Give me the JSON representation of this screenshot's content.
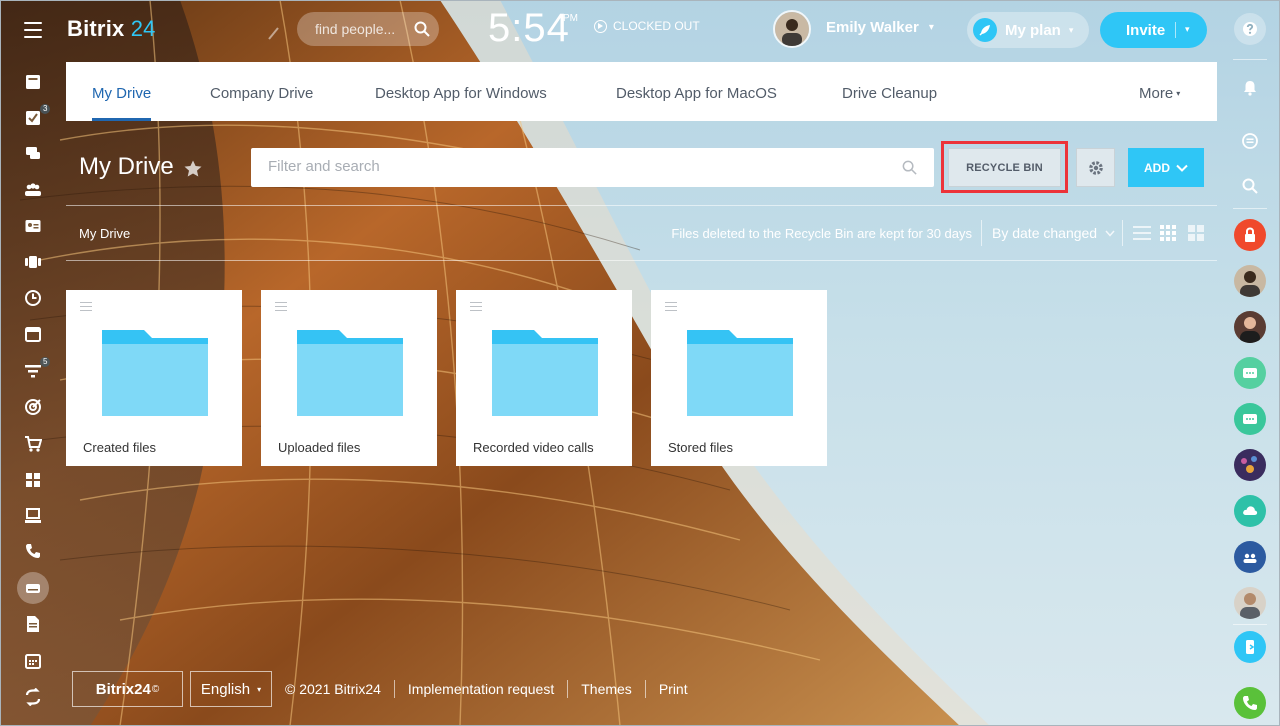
{
  "header": {
    "logo_name": "Bitrix",
    "logo_num": "24",
    "search_placeholder": "find people...",
    "clock_time": "5:54",
    "clock_ampm": "PM",
    "clock_status": "CLOCKED OUT",
    "user_name": "Emily Walker",
    "my_plan_label": "My plan",
    "invite_label": "Invite"
  },
  "left_nav": {
    "badges": {
      "tasks": "3",
      "crm": "5"
    },
    "icons": [
      "feed-icon",
      "tasks-icon",
      "chat-icon",
      "workgroups-icon",
      "contact-card-icon",
      "video-conference-icon",
      "time-clock-icon",
      "calendar-icon",
      "crm-funnel-icon",
      "target-icon",
      "shop-cart-icon",
      "apps-grid-icon",
      "sites-icon",
      "telephony-icon",
      "drive-icon",
      "documents-icon",
      "schedule-icon",
      "sync-icon"
    ]
  },
  "tabs": [
    {
      "label": "My Drive",
      "active": true
    },
    {
      "label": "Company Drive"
    },
    {
      "label": "Desktop App for Windows"
    },
    {
      "label": "Desktop App for MacOS"
    },
    {
      "label": "Drive Cleanup"
    }
  ],
  "tabs_more": "More",
  "toolbar": {
    "page_title": "My Drive",
    "filter_placeholder": "Filter and search",
    "recycle_bin_label": "RECYCLE BIN",
    "add_label": "ADD"
  },
  "info_bar": {
    "breadcrumb": "My Drive",
    "hint": "Files deleted to the Recycle Bin are kept for 30 days",
    "sort_label": "By date changed"
  },
  "folders": [
    {
      "name": "Created files"
    },
    {
      "name": "Uploaded files"
    },
    {
      "name": "Recorded video calls"
    },
    {
      "name": "Stored files"
    }
  ],
  "footer": {
    "logo": "Bitrix24",
    "logo_mark": "©",
    "language": "English",
    "copyright": "© 2021 Bitrix24",
    "links": [
      "Implementation request",
      "Themes",
      "Print"
    ]
  },
  "colors": {
    "accent": "#2fc6f6",
    "active_tab": "#2067b0",
    "highlight": "#ec3339",
    "folder": "#7fd9f7",
    "folder_tab": "#35c3f4"
  }
}
